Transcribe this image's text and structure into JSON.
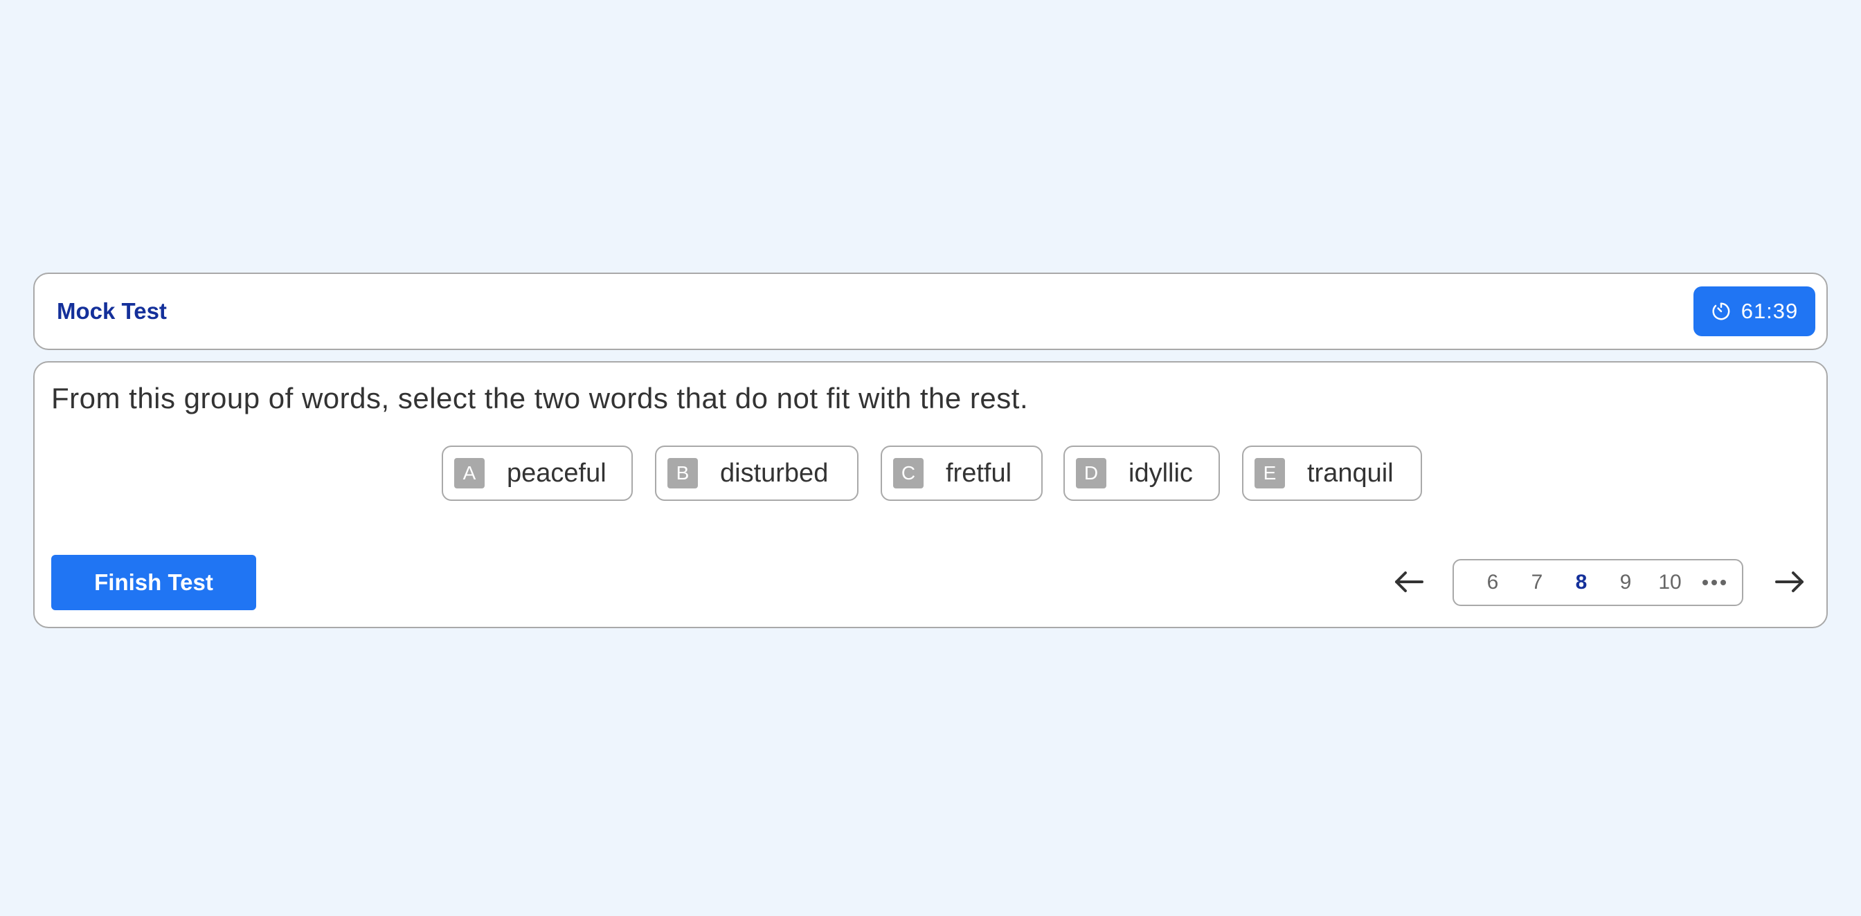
{
  "header": {
    "title": "Mock Test",
    "timer": {
      "icon": "timer-icon",
      "value": "61:39"
    }
  },
  "question": {
    "text": "From this group of words, select the two words that do not fit with the rest.",
    "options": [
      {
        "letter": "A",
        "word": "peaceful"
      },
      {
        "letter": "B",
        "word": "disturbed"
      },
      {
        "letter": "C",
        "word": "fretful"
      },
      {
        "letter": "D",
        "word": "idyllic"
      },
      {
        "letter": "E",
        "word": "tranquil"
      }
    ]
  },
  "footer": {
    "finish_label": "Finish Test",
    "pagination": {
      "pages": [
        "6",
        "7",
        "8",
        "9",
        "10"
      ],
      "current": "8",
      "prev_icon": "arrow-left-icon",
      "next_icon": "arrow-right-icon",
      "more_icon": "ellipsis-icon"
    }
  },
  "colors": {
    "background": "#eef5fd",
    "accent": "#2075f3",
    "title": "#14309a",
    "border": "#a9a9a9",
    "letter_badge": "#a9a9a9"
  }
}
